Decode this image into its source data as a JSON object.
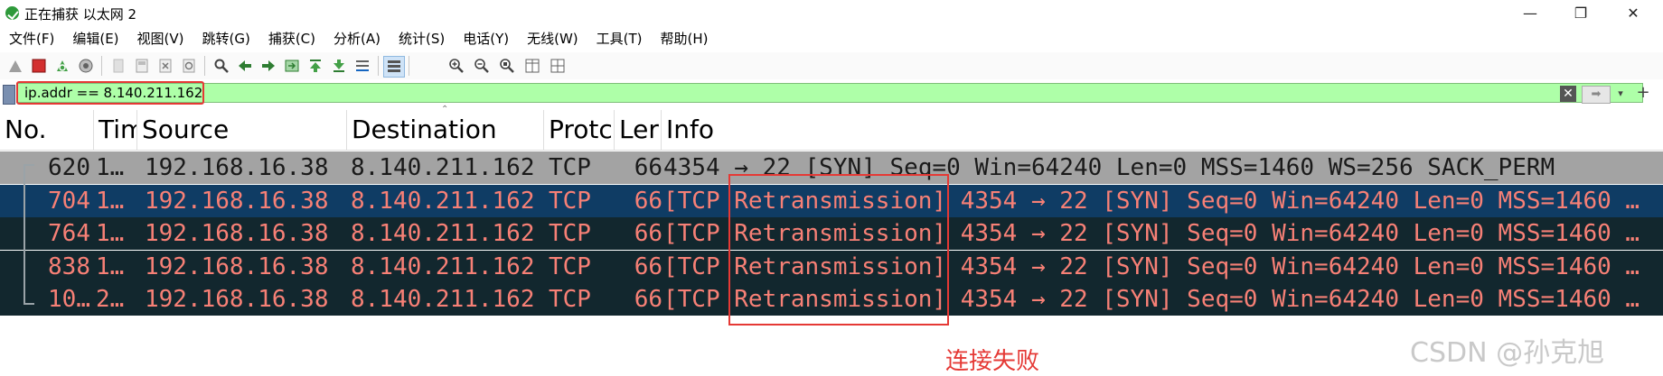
{
  "window": {
    "title": "正在捕获 以太网 2",
    "minimize_glyph": "—",
    "maximize_glyph": "❐",
    "close_glyph": "✕"
  },
  "menu": [
    {
      "label": "文件(F)"
    },
    {
      "label": "编辑(E)"
    },
    {
      "label": "视图(V)"
    },
    {
      "label": "跳转(G)"
    },
    {
      "label": "捕获(C)"
    },
    {
      "label": "分析(A)"
    },
    {
      "label": "统计(S)"
    },
    {
      "label": "电话(Y)"
    },
    {
      "label": "无线(W)"
    },
    {
      "label": "工具(T)"
    },
    {
      "label": "帮助(H)"
    }
  ],
  "toolbar": {
    "icons": [
      "shark-fin-start-icon",
      "stop-capture-icon",
      "restart-capture-icon",
      "capture-options-icon",
      "open-file-icon",
      "save-file-icon",
      "close-file-icon",
      "reload-file-icon",
      "find-packet-icon",
      "go-back-icon",
      "go-forward-icon",
      "go-to-packet-icon",
      "go-first-icon",
      "go-last-icon",
      "auto-scroll-icon",
      "colorize-icon",
      "zoom-in-icon",
      "zoom-out-icon",
      "zoom-normal-icon",
      "resize-columns-icon",
      "layout-icon"
    ],
    "icon_color_stop": "#d32f2f",
    "icon_color_nav": "#2e7d32"
  },
  "filter": {
    "value": "ip.addr == 8.140.211.162",
    "background": "#aeffa8",
    "clear_glyph": "✕",
    "apply_glyph": "➡",
    "dropdown_glyph": "▾",
    "add_glyph": "+"
  },
  "packet_list": {
    "columns": [
      "No.",
      "Time",
      "Source",
      "Destination",
      "Protocol",
      "Length",
      "Info"
    ],
    "column_headers_display": [
      "No.",
      "Tim",
      "Source",
      "Destination",
      "Protc",
      "Ler",
      "Info"
    ],
    "rows": [
      {
        "no": "620",
        "time": "1…",
        "source": "192.168.16.38",
        "destination": "8.140.211.162",
        "protocol": "TCP",
        "length": "66",
        "info": "4354 → 22 [SYN] Seq=0 Win=64240 Len=0 MSS=1460 WS=256 SACK_PERM"
      },
      {
        "no": "704",
        "time": "1…",
        "source": "192.168.16.38",
        "destination": "8.140.211.162",
        "protocol": "TCP",
        "length": "66",
        "info": "[TCP Retransmission] 4354 → 22 [SYN] Seq=0 Win=64240 Len=0 MSS=1460 …"
      },
      {
        "no": "764",
        "time": "1…",
        "source": "192.168.16.38",
        "destination": "8.140.211.162",
        "protocol": "TCP",
        "length": "66",
        "info": "[TCP Retransmission] 4354 → 22 [SYN] Seq=0 Win=64240 Len=0 MSS=1460 …"
      },
      {
        "no": "838",
        "time": "1…",
        "source": "192.168.16.38",
        "destination": "8.140.211.162",
        "protocol": "TCP",
        "length": "66",
        "info": "[TCP Retransmission] 4354 → 22 [SYN] Seq=0 Win=64240 Len=0 MSS=1460 …"
      },
      {
        "no": "10…",
        "time": "2…",
        "source": "192.168.16.38",
        "destination": "8.140.211.162",
        "protocol": "TCP",
        "length": "66",
        "info": "[TCP Retransmission] 4354 → 22 [SYN] Seq=0 Win=64240 Len=0 MSS=1460 …"
      }
    ],
    "colors": {
      "first_row_bg": "#a3a3a3",
      "selected_bg": "#0f3c64",
      "dark_bg": "#12272e",
      "retrans_text": "#f78076"
    }
  },
  "annotation": {
    "text": "连接失败",
    "color": "#e53935"
  },
  "watermark": "CSDN @孙克旭"
}
